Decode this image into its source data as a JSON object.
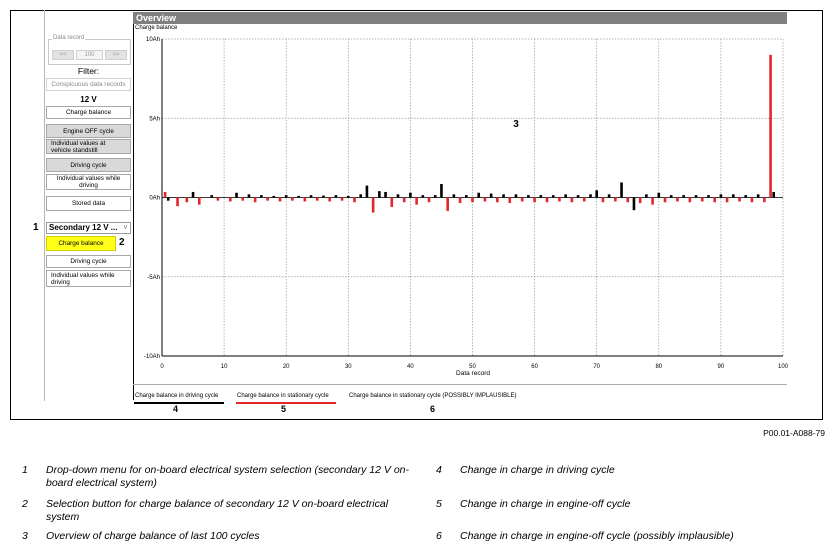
{
  "header": {
    "title": "Overview",
    "chart_subtitle": "Charge balance"
  },
  "sidebar": {
    "data_record_legend": "Data record",
    "prev_label": "<<",
    "record_value": "100",
    "next_label": ">>",
    "filter_label": "Filter:",
    "conspicuous_label": "Conspicuous data records",
    "section_12v": "12 V",
    "items_12v": [
      "Charge balance",
      "Engine OFF cycle",
      "Individual values at vehicle standstill",
      "Driving cycle",
      "Individual values while driving",
      "Stored data"
    ],
    "dropdown_value": "Secondary 12 V ...",
    "items_secondary": [
      "Charge balance",
      "Driving cycle",
      "Individual values while driving"
    ]
  },
  "callouts": [
    "1",
    "2",
    "3",
    "4",
    "5",
    "6"
  ],
  "legend": {
    "items": [
      {
        "label": "Charge balance in driving cycle",
        "color": "#000000",
        "num": "4"
      },
      {
        "label": "Charge balance in stationary cycle",
        "color": "#e3262b",
        "num": "5"
      },
      {
        "label": "Charge balance in stationary cycle (POSSIBLY IMPLAUSIBLE)",
        "color": "#ffffff",
        "num": "6"
      }
    ]
  },
  "figure_ref": "P00.01-A088-79",
  "captions": [
    {
      "num": "1",
      "text": "Drop-down menu for on-board electrical system selection (secondary 12 V on-board electrical system)"
    },
    {
      "num": "2",
      "text": "Selection button for charge balance of secondary 12 V on-board electrical system"
    },
    {
      "num": "3",
      "text": "Overview of charge balance of last 100 cycles"
    },
    {
      "num": "4",
      "text": "Change in charge in driving cycle"
    },
    {
      "num": "5",
      "text": "Change in charge in engine-off cycle"
    },
    {
      "num": "6",
      "text": "Change in charge in engine-off cycle (possibly implausible)"
    }
  ],
  "chart_data": {
    "type": "bar",
    "title": "Charge balance",
    "xlabel": "Data record",
    "ylabel": "",
    "xlim": [
      0,
      100
    ],
    "ylim": [
      -10,
      10
    ],
    "x_ticks": [
      "0",
      "10",
      "20",
      "30",
      "40",
      "50",
      "60",
      "70",
      "80",
      "90",
      "100"
    ],
    "y_ticks": [
      "10Ah",
      "5Ah",
      "0Ah",
      "-5Ah",
      "-10Ah"
    ],
    "grid": true,
    "series": [
      {
        "name": "Charge balance in driving cycle",
        "color": "#000000",
        "x": [
          1,
          5,
          8,
          12,
          14,
          16,
          18,
          20,
          22,
          24,
          26,
          28,
          30,
          32,
          33,
          35,
          36,
          38,
          40,
          42,
          44,
          45,
          47,
          49,
          51,
          53,
          55,
          57,
          59,
          61,
          63,
          65,
          67,
          69,
          70,
          72,
          74,
          76,
          78,
          80,
          82,
          84,
          86,
          88,
          90,
          92,
          94,
          96,
          98.5
        ],
        "values": [
          -0.2,
          0.35,
          0.15,
          0.3,
          0.2,
          0.15,
          0.1,
          0.15,
          0.1,
          0.15,
          0.12,
          0.15,
          0.1,
          0.2,
          0.75,
          0.4,
          0.35,
          0.2,
          0.3,
          0.15,
          0.15,
          0.85,
          0.2,
          0.15,
          0.3,
          0.25,
          0.2,
          0.2,
          0.15,
          0.15,
          0.15,
          0.2,
          0.15,
          0.2,
          0.45,
          0.2,
          0.95,
          -0.8,
          0.2,
          0.3,
          0.15,
          0.15,
          0.15,
          0.15,
          0.2,
          0.2,
          0.15,
          0.2,
          0.35
        ]
      },
      {
        "name": "Charge balance in stationary cycle",
        "color": "#e3262b",
        "x": [
          0.5,
          2.5,
          4,
          6,
          9,
          11,
          13,
          15,
          17,
          19,
          21,
          23,
          25,
          27,
          29,
          31,
          34,
          37,
          39,
          41,
          43,
          46,
          48,
          50,
          52,
          54,
          56,
          58,
          60,
          62,
          64,
          66,
          68,
          71,
          73,
          75,
          77,
          79,
          81,
          83,
          85,
          87,
          89,
          91,
          93,
          95,
          97,
          98
        ],
        "values": [
          0.35,
          -0.55,
          -0.3,
          -0.45,
          -0.2,
          -0.25,
          -0.2,
          -0.3,
          -0.2,
          -0.25,
          -0.2,
          -0.25,
          -0.2,
          -0.25,
          -0.2,
          -0.3,
          -0.95,
          -0.6,
          -0.3,
          -0.45,
          -0.3,
          -0.85,
          -0.35,
          -0.3,
          -0.25,
          -0.3,
          -0.35,
          -0.25,
          -0.3,
          -0.3,
          -0.25,
          -0.3,
          -0.25,
          -0.3,
          -0.25,
          -0.3,
          -0.35,
          -0.45,
          -0.3,
          -0.25,
          -0.3,
          -0.25,
          -0.3,
          -0.3,
          -0.25,
          -0.3,
          -0.3,
          9.0
        ]
      }
    ]
  }
}
